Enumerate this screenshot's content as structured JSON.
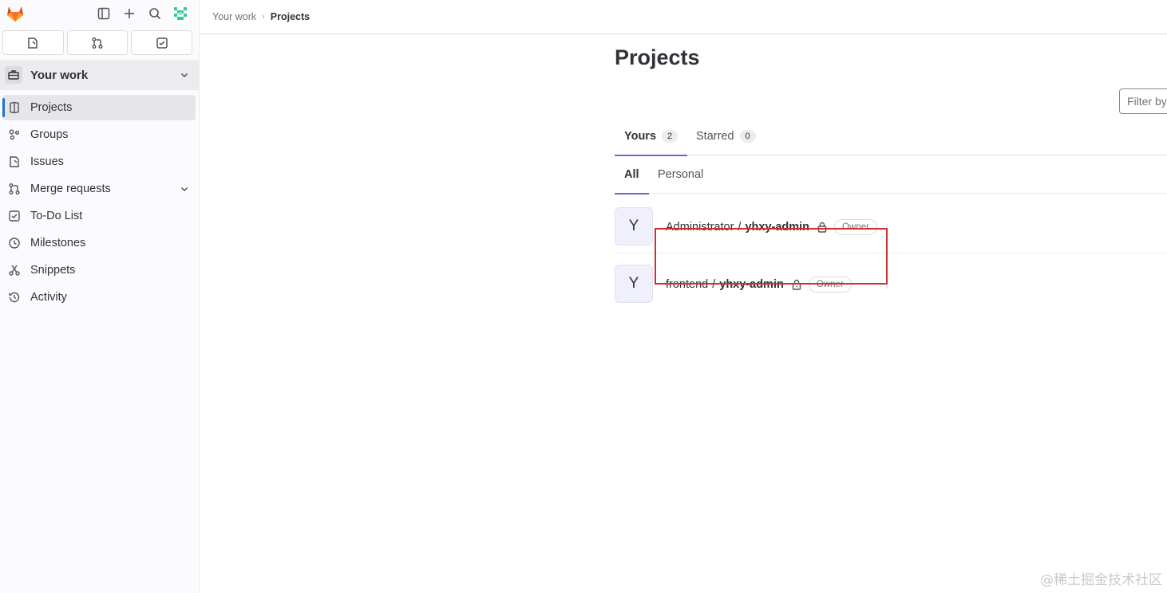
{
  "sidebar": {
    "context_label": "Your work",
    "items": [
      {
        "label": "Projects",
        "icon": "project-icon",
        "active": true
      },
      {
        "label": "Groups",
        "icon": "group-icon"
      },
      {
        "label": "Issues",
        "icon": "issues-icon"
      },
      {
        "label": "Merge requests",
        "icon": "merge-request-icon",
        "expandable": true
      },
      {
        "label": "To-Do List",
        "icon": "todo-icon"
      },
      {
        "label": "Milestones",
        "icon": "milestone-icon"
      },
      {
        "label": "Snippets",
        "icon": "snippet-icon"
      },
      {
        "label": "Activity",
        "icon": "history-icon"
      }
    ]
  },
  "breadcrumb": {
    "parent": "Your work",
    "current": "Projects"
  },
  "main": {
    "title": "Projects",
    "tabs": [
      {
        "label": "Yours",
        "count": "2",
        "active": true
      },
      {
        "label": "Starred",
        "count": "0"
      }
    ],
    "subtabs": [
      {
        "label": "All",
        "active": true
      },
      {
        "label": "Personal"
      }
    ],
    "filter_placeholder": "Filter by",
    "projects": [
      {
        "avatar": "Y",
        "namespace": "Administrator",
        "name": "yhxy-admin",
        "role": "Owner"
      },
      {
        "avatar": "Y",
        "namespace": "frontend",
        "name": "yhxy-admin",
        "role": "Owner"
      }
    ]
  },
  "colors": {
    "accent": "#6666c4",
    "active_indicator": "#1f75cb",
    "highlight_box": "#d32f2f"
  },
  "watermark": "@稀土掘金技术社区"
}
